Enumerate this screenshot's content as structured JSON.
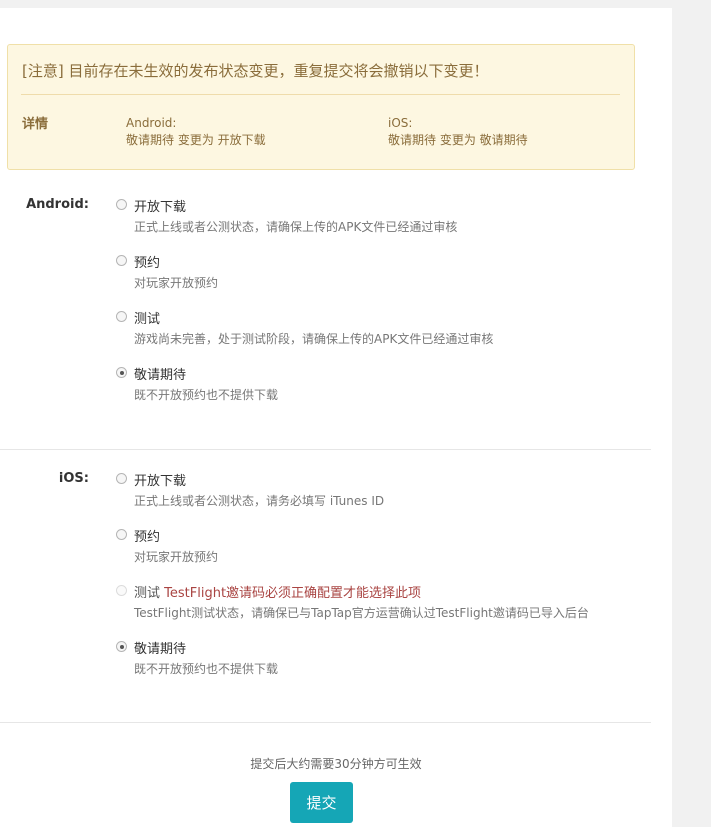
{
  "notice": {
    "title": "[注意] 目前存在未生效的发布状态变更，重复提交将会撤销以下变更！",
    "details_label": "详情",
    "android_platform": "Android:",
    "android_change": "敬请期待 变更为 开放下载",
    "ios_platform": "iOS:",
    "ios_change": "敬请期待 变更为 敬请期待"
  },
  "android": {
    "label": "Android:",
    "options": [
      {
        "title": "开放下载",
        "desc": "正式上线或者公测状态，请确保上传的APK文件已经通过审核",
        "checked": false
      },
      {
        "title": "预约",
        "desc": "对玩家开放预约",
        "checked": false
      },
      {
        "title": "测试",
        "desc": "游戏尚未完善，处于测试阶段，请确保上传的APK文件已经通过审核",
        "checked": false
      },
      {
        "title": "敬请期待",
        "desc": "既不开放预约也不提供下载",
        "checked": true
      }
    ]
  },
  "ios": {
    "label": "iOS:",
    "options": [
      {
        "title": "开放下载",
        "desc": "正式上线或者公测状态，请务必填写 iTunes ID",
        "checked": false
      },
      {
        "title": "预约",
        "desc": "对玩家开放预约",
        "checked": false
      },
      {
        "title": "测试",
        "title_warning": "TestFlight邀请码必须正确配置才能选择此项",
        "desc": "TestFlight测试状态，请确保已与TapTap官方运营确认过TestFlight邀请码已导入后台",
        "checked": false,
        "disabled": true
      },
      {
        "title": "敬请期待",
        "desc": "既不开放预约也不提供下载",
        "checked": true
      }
    ]
  },
  "footer": {
    "note": "提交后大约需要30分钟方可生效",
    "submit_label": "提交"
  },
  "colors": {
    "accent": "#15a6b6",
    "notice_bg": "#fdf7e1",
    "notice_text": "#8a6d3b",
    "warning_text": "#a94442"
  }
}
